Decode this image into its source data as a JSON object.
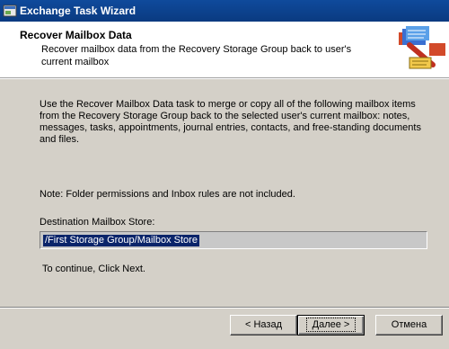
{
  "window": {
    "title": "Exchange Task Wizard"
  },
  "header": {
    "title": "Recover Mailbox Data",
    "description": "Recover mailbox data from the Recovery Storage Group back to user's current mailbox"
  },
  "body": {
    "text": "Use the Recover Mailbox Data task to merge or copy all of the following mailbox items from the Recovery Storage Group back to the selected user's current mailbox: notes, messages, tasks, appointments, journal entries, contacts, and free-standing documents and files.",
    "note": "Note: Folder permissions and Inbox rules are not included.",
    "destination_label": "Destination Mailbox Store:",
    "destination_value": "/First Storage Group/Mailbox Store",
    "continue_text": "To continue, Click Next."
  },
  "buttons": {
    "back": "< Назад",
    "next": "Далее >",
    "cancel": "Отмена"
  },
  "icons": {
    "app": "wizard-app-icon",
    "header": "wizard-graphic-icon"
  }
}
